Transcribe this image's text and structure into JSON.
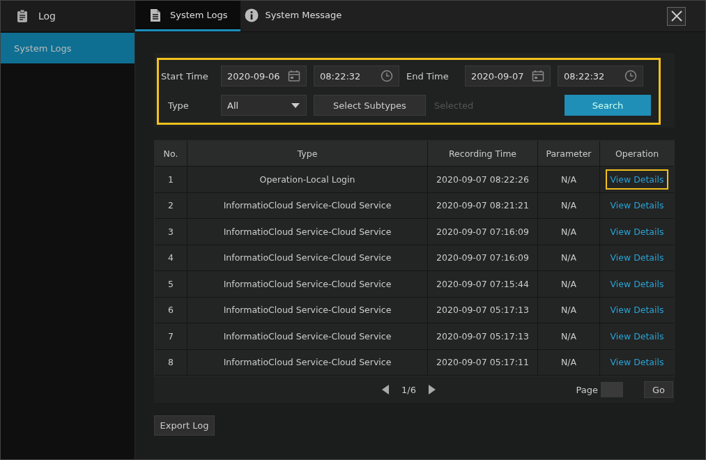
{
  "sidebar": {
    "title": "Log",
    "items": [
      {
        "label": "System Logs",
        "selected": true
      }
    ]
  },
  "tabs": [
    {
      "label": "System Logs",
      "kind": "logs",
      "selected": true
    },
    {
      "label": "System Message",
      "kind": "message",
      "selected": false
    }
  ],
  "filters": {
    "highlighted": true,
    "start_label": "Start Time",
    "start_date": "2020-09-06",
    "start_time": "08:22:32",
    "end_label": "End Time",
    "end_date": "2020-09-07",
    "end_time": "08:22:32",
    "type_label": "Type",
    "type_value": "All",
    "subtypes_button": "Select Subtypes",
    "selected_text": "Selected",
    "search_button": "Search"
  },
  "table": {
    "columns": [
      "No.",
      "Type",
      "Recording Time",
      "Parameter",
      "Operation"
    ],
    "rows": [
      {
        "no": "1",
        "type": "Operation-Local Login",
        "time": "2020-09-07 08:22:26",
        "parameter": "N/A",
        "operation": "View Details",
        "highlighted": true
      },
      {
        "no": "2",
        "type": "InformatioCloud Service-Cloud Service",
        "time": "2020-09-07 08:21:21",
        "parameter": "N/A",
        "operation": "View Details",
        "highlighted": false
      },
      {
        "no": "3",
        "type": "InformatioCloud Service-Cloud Service",
        "time": "2020-09-07 07:16:09",
        "parameter": "N/A",
        "operation": "View Details",
        "highlighted": false
      },
      {
        "no": "4",
        "type": "InformatioCloud Service-Cloud Service",
        "time": "2020-09-07 07:16:09",
        "parameter": "N/A",
        "operation": "View Details",
        "highlighted": false
      },
      {
        "no": "5",
        "type": "InformatioCloud Service-Cloud Service",
        "time": "2020-09-07 07:15:44",
        "parameter": "N/A",
        "operation": "View Details",
        "highlighted": false
      },
      {
        "no": "6",
        "type": "InformatioCloud Service-Cloud Service",
        "time": "2020-09-07 05:17:13",
        "parameter": "N/A",
        "operation": "View Details",
        "highlighted": false
      },
      {
        "no": "7",
        "type": "InformatioCloud Service-Cloud Service",
        "time": "2020-09-07 05:17:13",
        "parameter": "N/A",
        "operation": "View Details",
        "highlighted": false
      },
      {
        "no": "8",
        "type": "InformatioCloud Service-Cloud Service",
        "time": "2020-09-07 05:17:11",
        "parameter": "N/A",
        "operation": "View Details",
        "highlighted": false
      }
    ]
  },
  "pagination": {
    "page": "1/6",
    "page_label": "Page",
    "go_button": "Go"
  },
  "export_button": "Export Log"
}
